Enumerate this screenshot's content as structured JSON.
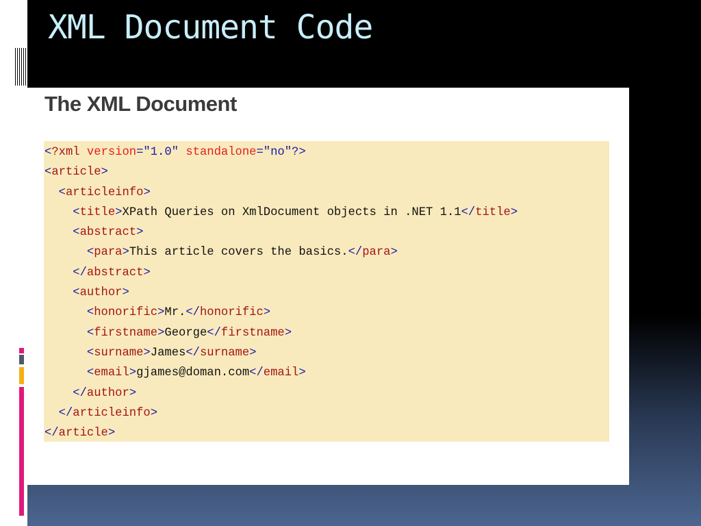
{
  "slide": {
    "title": "XML Document Code"
  },
  "card": {
    "heading": "The XML Document"
  },
  "colors": {
    "bracket": "#1a1aa6",
    "tag": "#a31515",
    "attribute": "#e21f1f",
    "value": "#1a1aa6",
    "code_bg": "#f9eabd"
  },
  "code_lines": [
    [
      [
        "b",
        "<"
      ],
      [
        "t",
        "?xml "
      ],
      [
        "a",
        "version"
      ],
      [
        "b",
        "=\"1.0\" "
      ],
      [
        "a",
        "standalone"
      ],
      [
        "b",
        "=\"no\"?>"
      ]
    ],
    [
      [
        "b",
        "<"
      ],
      [
        "t",
        "article"
      ],
      [
        "b",
        ">"
      ]
    ],
    [
      [
        "x",
        "  "
      ],
      [
        "b",
        "<"
      ],
      [
        "t",
        "articleinfo"
      ],
      [
        "b",
        ">"
      ]
    ],
    [
      [
        "x",
        "    "
      ],
      [
        "b",
        "<"
      ],
      [
        "t",
        "title"
      ],
      [
        "b",
        ">"
      ],
      [
        "x",
        "XPath Queries on XmlDocument objects in .NET 1.1"
      ],
      [
        "b",
        "</"
      ],
      [
        "t",
        "title"
      ],
      [
        "b",
        ">"
      ]
    ],
    [
      [
        "x",
        "    "
      ],
      [
        "b",
        "<"
      ],
      [
        "t",
        "abstract"
      ],
      [
        "b",
        ">"
      ]
    ],
    [
      [
        "x",
        "      "
      ],
      [
        "b",
        "<"
      ],
      [
        "t",
        "para"
      ],
      [
        "b",
        ">"
      ],
      [
        "x",
        "This article covers the basics."
      ],
      [
        "b",
        "</"
      ],
      [
        "t",
        "para"
      ],
      [
        "b",
        ">"
      ]
    ],
    [
      [
        "x",
        "    "
      ],
      [
        "b",
        "</"
      ],
      [
        "t",
        "abstract"
      ],
      [
        "b",
        ">"
      ]
    ],
    [
      [
        "x",
        "    "
      ],
      [
        "b",
        "<"
      ],
      [
        "t",
        "author"
      ],
      [
        "b",
        ">"
      ]
    ],
    [
      [
        "x",
        "      "
      ],
      [
        "b",
        "<"
      ],
      [
        "t",
        "honorific"
      ],
      [
        "b",
        ">"
      ],
      [
        "x",
        "Mr."
      ],
      [
        "b",
        "</"
      ],
      [
        "t",
        "honorific"
      ],
      [
        "b",
        ">"
      ]
    ],
    [
      [
        "x",
        "      "
      ],
      [
        "b",
        "<"
      ],
      [
        "t",
        "firstname"
      ],
      [
        "b",
        ">"
      ],
      [
        "x",
        "George"
      ],
      [
        "b",
        "</"
      ],
      [
        "t",
        "firstname"
      ],
      [
        "b",
        ">"
      ]
    ],
    [
      [
        "x",
        "      "
      ],
      [
        "b",
        "<"
      ],
      [
        "t",
        "surname"
      ],
      [
        "b",
        ">"
      ],
      [
        "x",
        "James"
      ],
      [
        "b",
        "</"
      ],
      [
        "t",
        "surname"
      ],
      [
        "b",
        ">"
      ]
    ],
    [
      [
        "x",
        "      "
      ],
      [
        "b",
        "<"
      ],
      [
        "t",
        "email"
      ],
      [
        "b",
        ">"
      ],
      [
        "x",
        "gjames@doman.com"
      ],
      [
        "b",
        "</"
      ],
      [
        "t",
        "email"
      ],
      [
        "b",
        ">"
      ]
    ],
    [
      [
        "x",
        "    "
      ],
      [
        "b",
        "</"
      ],
      [
        "t",
        "author"
      ],
      [
        "b",
        ">"
      ]
    ],
    [
      [
        "x",
        "  "
      ],
      [
        "b",
        "</"
      ],
      [
        "t",
        "articleinfo"
      ],
      [
        "b",
        ">"
      ]
    ],
    [
      [
        "b",
        "</"
      ],
      [
        "t",
        "article"
      ],
      [
        "b",
        ">"
      ]
    ]
  ]
}
